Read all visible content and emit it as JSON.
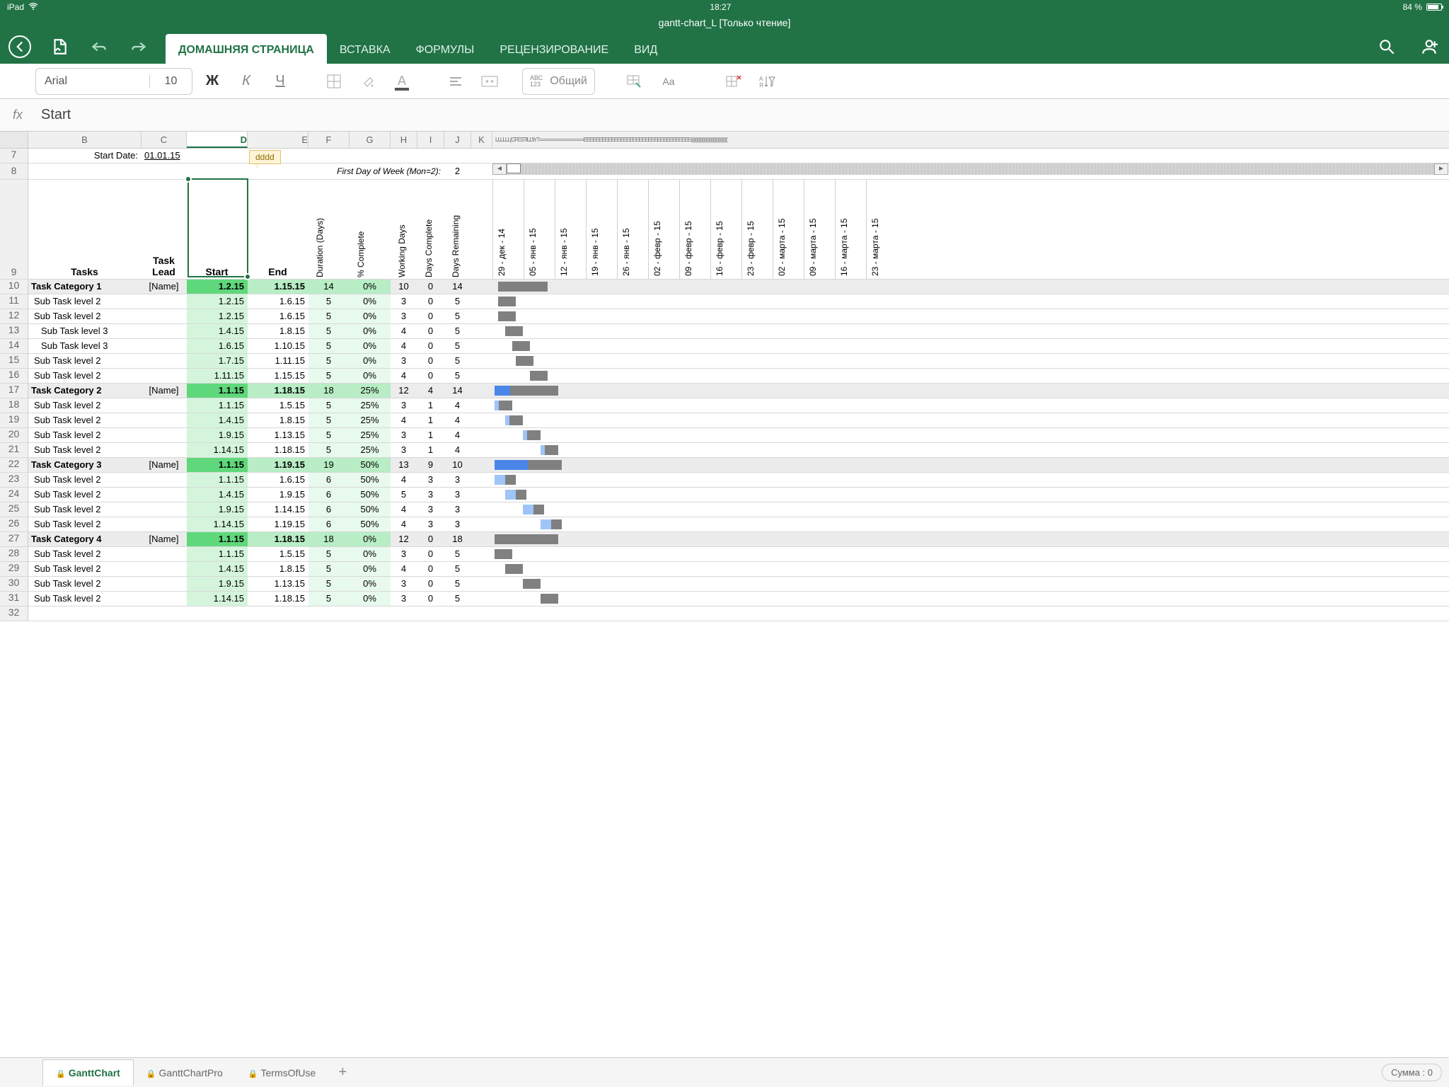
{
  "status": {
    "device": "iPad",
    "time": "18:27",
    "battery": "84 %"
  },
  "doc": {
    "name": "gantt-chart_L",
    "readonly": "[Только чтение]"
  },
  "tabs": [
    "ДОМАШНЯЯ СТРАНИЦА",
    "ВСТАВКА",
    "ФОРМУЛЫ",
    "РЕЦЕНЗИРОВАНИЕ",
    "ВИД"
  ],
  "font": {
    "name": "Arial",
    "size": "10",
    "format_group": "Общий"
  },
  "formula": {
    "value": "Start"
  },
  "cols": [
    "B",
    "C",
    "D",
    "E",
    "F",
    "G",
    "H",
    "I",
    "J",
    "K"
  ],
  "cols_overflow": "LLLLLL(CFESTILL\\\\Y7=================EEEEEEEEEEEEEEEEEEEEEEEEEEEEEEEEEEE(((((((((((((((((((((((((((((((",
  "row7": {
    "label": "Start Date:",
    "value": "01.01.15"
  },
  "row8": {
    "label": "First Day of Week (Mon=2):",
    "value": "2"
  },
  "headers": {
    "B": "Tasks",
    "C_top": "Task",
    "C_bot": "Lead",
    "D": "Start",
    "E": "End",
    "F": "Duration (Days)",
    "G": "% Complete",
    "H": "Working Days",
    "I": "Days Complete",
    "J": "Days Remaining"
  },
  "dates": [
    "29 - дек - 14",
    "05 - янв - 15",
    "12 - янв - 15",
    "19 - янв - 15",
    "26 - янв - 15",
    "02 - февр - 15",
    "09 - февр - 15",
    "16 - февр - 15",
    "23 - февр - 15",
    "02 - марта - 15",
    "09 - марта - 15",
    "16 - марта - 15",
    "23 - марта - 15"
  ],
  "rows": [
    {
      "n": 10,
      "cat": true,
      "task": "Task Category 1",
      "lead": "[Name]",
      "start": "1.2.15",
      "end": "1.15.15",
      "dur": "14",
      "pct": "0%",
      "wd": "10",
      "dc": "0",
      "dr": "14",
      "g_off": 8,
      "g_len": 70,
      "g_done": 0
    },
    {
      "n": 11,
      "task": "Sub Task level 2",
      "start": "1.2.15",
      "end": "1.6.15",
      "dur": "5",
      "pct": "0%",
      "wd": "3",
      "dc": "0",
      "dr": "5",
      "ind": 1,
      "g_off": 8,
      "g_len": 25,
      "g_done": 0
    },
    {
      "n": 12,
      "task": "Sub Task level 2",
      "start": "1.2.15",
      "end": "1.6.15",
      "dur": "5",
      "pct": "0%",
      "wd": "3",
      "dc": "0",
      "dr": "5",
      "ind": 1,
      "g_off": 8,
      "g_len": 25,
      "g_done": 0
    },
    {
      "n": 13,
      "task": "Sub Task level 3",
      "start": "1.4.15",
      "end": "1.8.15",
      "dur": "5",
      "pct": "0%",
      "wd": "4",
      "dc": "0",
      "dr": "5",
      "ind": 2,
      "g_off": 18,
      "g_len": 25,
      "g_done": 0
    },
    {
      "n": 14,
      "task": "Sub Task level 3",
      "start": "1.6.15",
      "end": "1.10.15",
      "dur": "5",
      "pct": "0%",
      "wd": "4",
      "dc": "0",
      "dr": "5",
      "ind": 2,
      "g_off": 28,
      "g_len": 25,
      "g_done": 0
    },
    {
      "n": 15,
      "task": "Sub Task level 2",
      "start": "1.7.15",
      "end": "1.11.15",
      "dur": "5",
      "pct": "0%",
      "wd": "3",
      "dc": "0",
      "dr": "5",
      "ind": 1,
      "g_off": 33,
      "g_len": 25,
      "g_done": 0
    },
    {
      "n": 16,
      "task": "Sub Task level 2",
      "start": "1.11.15",
      "end": "1.15.15",
      "dur": "5",
      "pct": "0%",
      "wd": "4",
      "dc": "0",
      "dr": "5",
      "ind": 1,
      "g_off": 53,
      "g_len": 25,
      "g_done": 0
    },
    {
      "n": 17,
      "cat": true,
      "task": "Task Category 2",
      "lead": "[Name]",
      "start": "1.1.15",
      "end": "1.18.15",
      "dur": "18",
      "pct": "25%",
      "wd": "12",
      "dc": "4",
      "dr": "14",
      "g_off": 3,
      "g_len": 90,
      "g_done": 22
    },
    {
      "n": 18,
      "task": "Sub Task level 2",
      "start": "1.1.15",
      "end": "1.5.15",
      "dur": "5",
      "pct": "25%",
      "wd": "3",
      "dc": "1",
      "dr": "4",
      "ind": 1,
      "g_off": 3,
      "g_len": 25,
      "g_done": 6,
      "light": true
    },
    {
      "n": 19,
      "task": "Sub Task level 2",
      "start": "1.4.15",
      "end": "1.8.15",
      "dur": "5",
      "pct": "25%",
      "wd": "4",
      "dc": "1",
      "dr": "4",
      "ind": 1,
      "g_off": 18,
      "g_len": 25,
      "g_done": 6,
      "light": true
    },
    {
      "n": 20,
      "task": "Sub Task level 2",
      "start": "1.9.15",
      "end": "1.13.15",
      "dur": "5",
      "pct": "25%",
      "wd": "3",
      "dc": "1",
      "dr": "4",
      "ind": 1,
      "g_off": 43,
      "g_len": 25,
      "g_done": 6,
      "light": true
    },
    {
      "n": 21,
      "task": "Sub Task level 2",
      "start": "1.14.15",
      "end": "1.18.15",
      "dur": "5",
      "pct": "25%",
      "wd": "3",
      "dc": "1",
      "dr": "4",
      "ind": 1,
      "g_off": 68,
      "g_len": 25,
      "g_done": 6,
      "light": true
    },
    {
      "n": 22,
      "cat": true,
      "task": "Task Category 3",
      "lead": "[Name]",
      "start": "1.1.15",
      "end": "1.19.15",
      "dur": "19",
      "pct": "50%",
      "wd": "13",
      "dc": "9",
      "dr": "10",
      "g_off": 3,
      "g_len": 95,
      "g_done": 47
    },
    {
      "n": 23,
      "task": "Sub Task level 2",
      "start": "1.1.15",
      "end": "1.6.15",
      "dur": "6",
      "pct": "50%",
      "wd": "4",
      "dc": "3",
      "dr": "3",
      "ind": 1,
      "g_off": 3,
      "g_len": 30,
      "g_done": 15,
      "light": true
    },
    {
      "n": 24,
      "task": "Sub Task level 2",
      "start": "1.4.15",
      "end": "1.9.15",
      "dur": "6",
      "pct": "50%",
      "wd": "5",
      "dc": "3",
      "dr": "3",
      "ind": 1,
      "g_off": 18,
      "g_len": 30,
      "g_done": 15,
      "light": true
    },
    {
      "n": 25,
      "task": "Sub Task level 2",
      "start": "1.9.15",
      "end": "1.14.15",
      "dur": "6",
      "pct": "50%",
      "wd": "4",
      "dc": "3",
      "dr": "3",
      "ind": 1,
      "g_off": 43,
      "g_len": 30,
      "g_done": 15,
      "light": true
    },
    {
      "n": 26,
      "task": "Sub Task level 2",
      "start": "1.14.15",
      "end": "1.19.15",
      "dur": "6",
      "pct": "50%",
      "wd": "4",
      "dc": "3",
      "dr": "3",
      "ind": 1,
      "g_off": 68,
      "g_len": 30,
      "g_done": 15,
      "light": true
    },
    {
      "n": 27,
      "cat": true,
      "task": "Task Category 4",
      "lead": "[Name]",
      "start": "1.1.15",
      "end": "1.18.15",
      "dur": "18",
      "pct": "0%",
      "wd": "12",
      "dc": "0",
      "dr": "18",
      "g_off": 3,
      "g_len": 90,
      "g_done": 0
    },
    {
      "n": 28,
      "task": "Sub Task level 2",
      "start": "1.1.15",
      "end": "1.5.15",
      "dur": "5",
      "pct": "0%",
      "wd": "3",
      "dc": "0",
      "dr": "5",
      "ind": 1,
      "g_off": 3,
      "g_len": 25,
      "g_done": 0
    },
    {
      "n": 29,
      "task": "Sub Task level 2",
      "start": "1.4.15",
      "end": "1.8.15",
      "dur": "5",
      "pct": "0%",
      "wd": "4",
      "dc": "0",
      "dr": "5",
      "ind": 1,
      "g_off": 18,
      "g_len": 25,
      "g_done": 0
    },
    {
      "n": 30,
      "task": "Sub Task level 2",
      "start": "1.9.15",
      "end": "1.13.15",
      "dur": "5",
      "pct": "0%",
      "wd": "3",
      "dc": "0",
      "dr": "5",
      "ind": 1,
      "g_off": 43,
      "g_len": 25,
      "g_done": 0
    },
    {
      "n": 31,
      "task": "Sub Task level 2",
      "start": "1.14.15",
      "end": "1.18.15",
      "dur": "5",
      "pct": "0%",
      "wd": "3",
      "dc": "0",
      "dr": "5",
      "ind": 1,
      "g_off": 68,
      "g_len": 25,
      "g_done": 0
    }
  ],
  "comment": "dddd",
  "sheets": [
    "GanttChart",
    "GanttChartPro",
    "TermsOfUse"
  ],
  "sum": "Сумма : 0"
}
